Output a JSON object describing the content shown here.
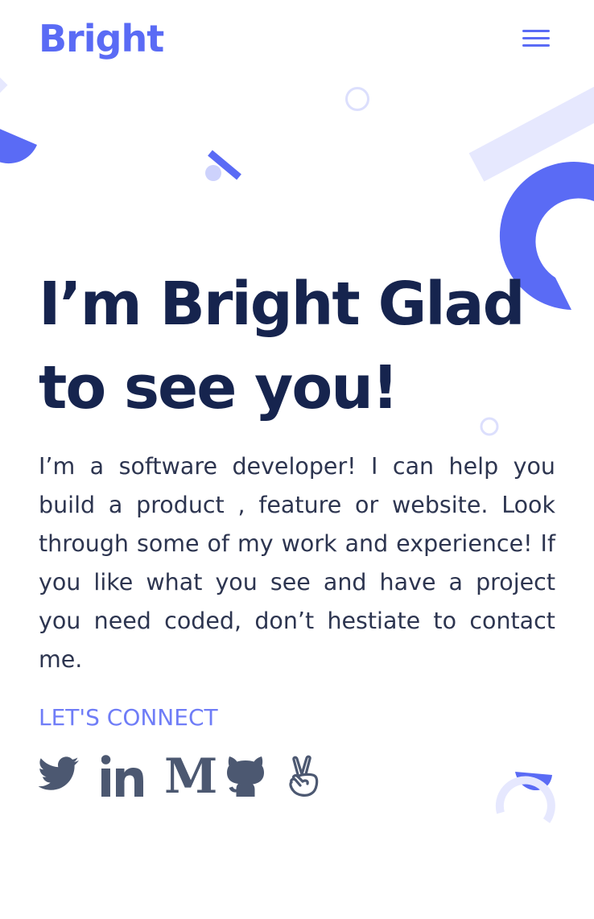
{
  "header": {
    "logo_text": "Bright",
    "menu_icon": "hamburger-menu-icon"
  },
  "hero": {
    "headline_line1": "I’m Bright Glad",
    "headline_line2": "to see you!",
    "intro": "I’m a software developer! I can help you build a product , feature or website. Look through some of my work and experience! If you like what you see and have a project you need coded, don’t hestiate to contact me."
  },
  "connect": {
    "heading": "LET'S CONNECT",
    "links": [
      {
        "icon": "twitter-icon"
      },
      {
        "icon": "linkedin-icon"
      },
      {
        "icon": "medium-icon",
        "glyph": "M"
      },
      {
        "icon": "github-icon"
      },
      {
        "icon": "angellist-icon"
      }
    ]
  },
  "colors": {
    "brand": "#5a6bf5",
    "brand_light": "#e6e8fe",
    "heading": "#16244e",
    "body_text": "#2d3550",
    "icon": "#4c5871",
    "accent_text": "#6f7df7"
  }
}
